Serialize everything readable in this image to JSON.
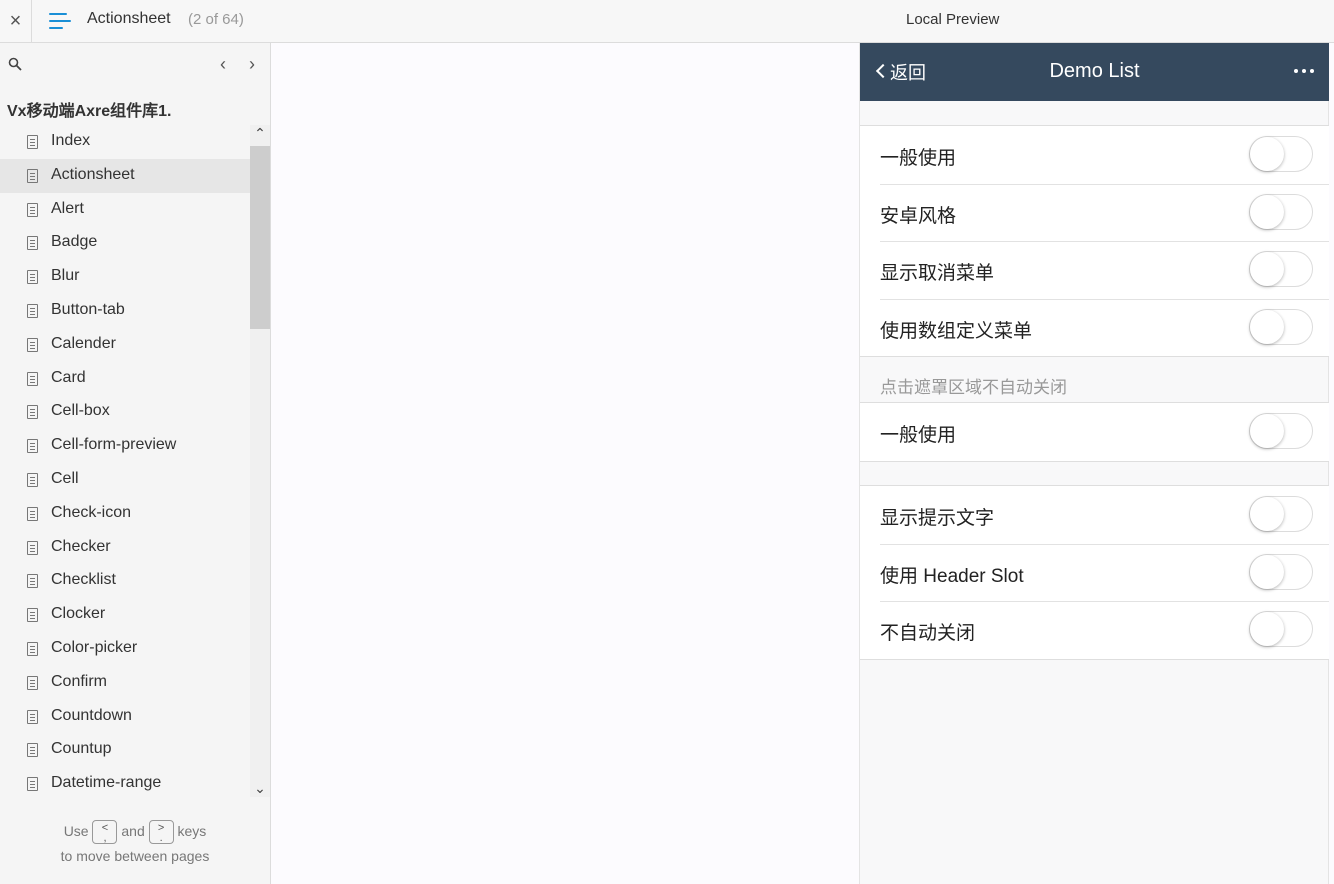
{
  "topbar": {
    "close_label": "×",
    "page_name": "Actionsheet",
    "page_count": "(2 of 64)",
    "preview_title": "Local Preview"
  },
  "sidebar": {
    "project_title": "Vx移动端Axre组件库1.",
    "prev_label": "‹",
    "next_label": "›",
    "pages": [
      {
        "label": "Index",
        "active": false
      },
      {
        "label": "Actionsheet",
        "active": true
      },
      {
        "label": "Alert",
        "active": false
      },
      {
        "label": "Badge",
        "active": false
      },
      {
        "label": "Blur",
        "active": false
      },
      {
        "label": "Button-tab",
        "active": false
      },
      {
        "label": "Calender",
        "active": false
      },
      {
        "label": "Card",
        "active": false
      },
      {
        "label": "Cell-box",
        "active": false
      },
      {
        "label": "Cell-form-preview",
        "active": false
      },
      {
        "label": "Cell",
        "active": false
      },
      {
        "label": "Check-icon",
        "active": false
      },
      {
        "label": "Checker",
        "active": false
      },
      {
        "label": "Checklist",
        "active": false
      },
      {
        "label": "Clocker",
        "active": false
      },
      {
        "label": "Color-picker",
        "active": false
      },
      {
        "label": "Confirm",
        "active": false
      },
      {
        "label": "Countdown",
        "active": false
      },
      {
        "label": "Countup",
        "active": false
      },
      {
        "label": "Datetime-range",
        "active": false
      }
    ],
    "hint": {
      "use": "Use",
      "key_prev": "<\n,",
      "and": "and",
      "key_next": ">\n.",
      "keys": "keys",
      "line2": "to move between pages"
    }
  },
  "mobile": {
    "back_label": "返回",
    "title": "Demo List",
    "group1": [
      {
        "label": "一般使用",
        "on": false
      },
      {
        "label": "安卓风格",
        "on": false
      },
      {
        "label": "显示取消菜单",
        "on": false
      },
      {
        "label": "使用数组定义菜单",
        "on": false
      }
    ],
    "group2_title": "点击遮罩区域不自动关闭",
    "group2": [
      {
        "label": "一般使用",
        "on": false
      }
    ],
    "group3": [
      {
        "label": "显示提示文字",
        "on": false
      },
      {
        "label": "使用 Header Slot",
        "on": false
      },
      {
        "label": "不自动关闭",
        "on": false
      }
    ]
  }
}
